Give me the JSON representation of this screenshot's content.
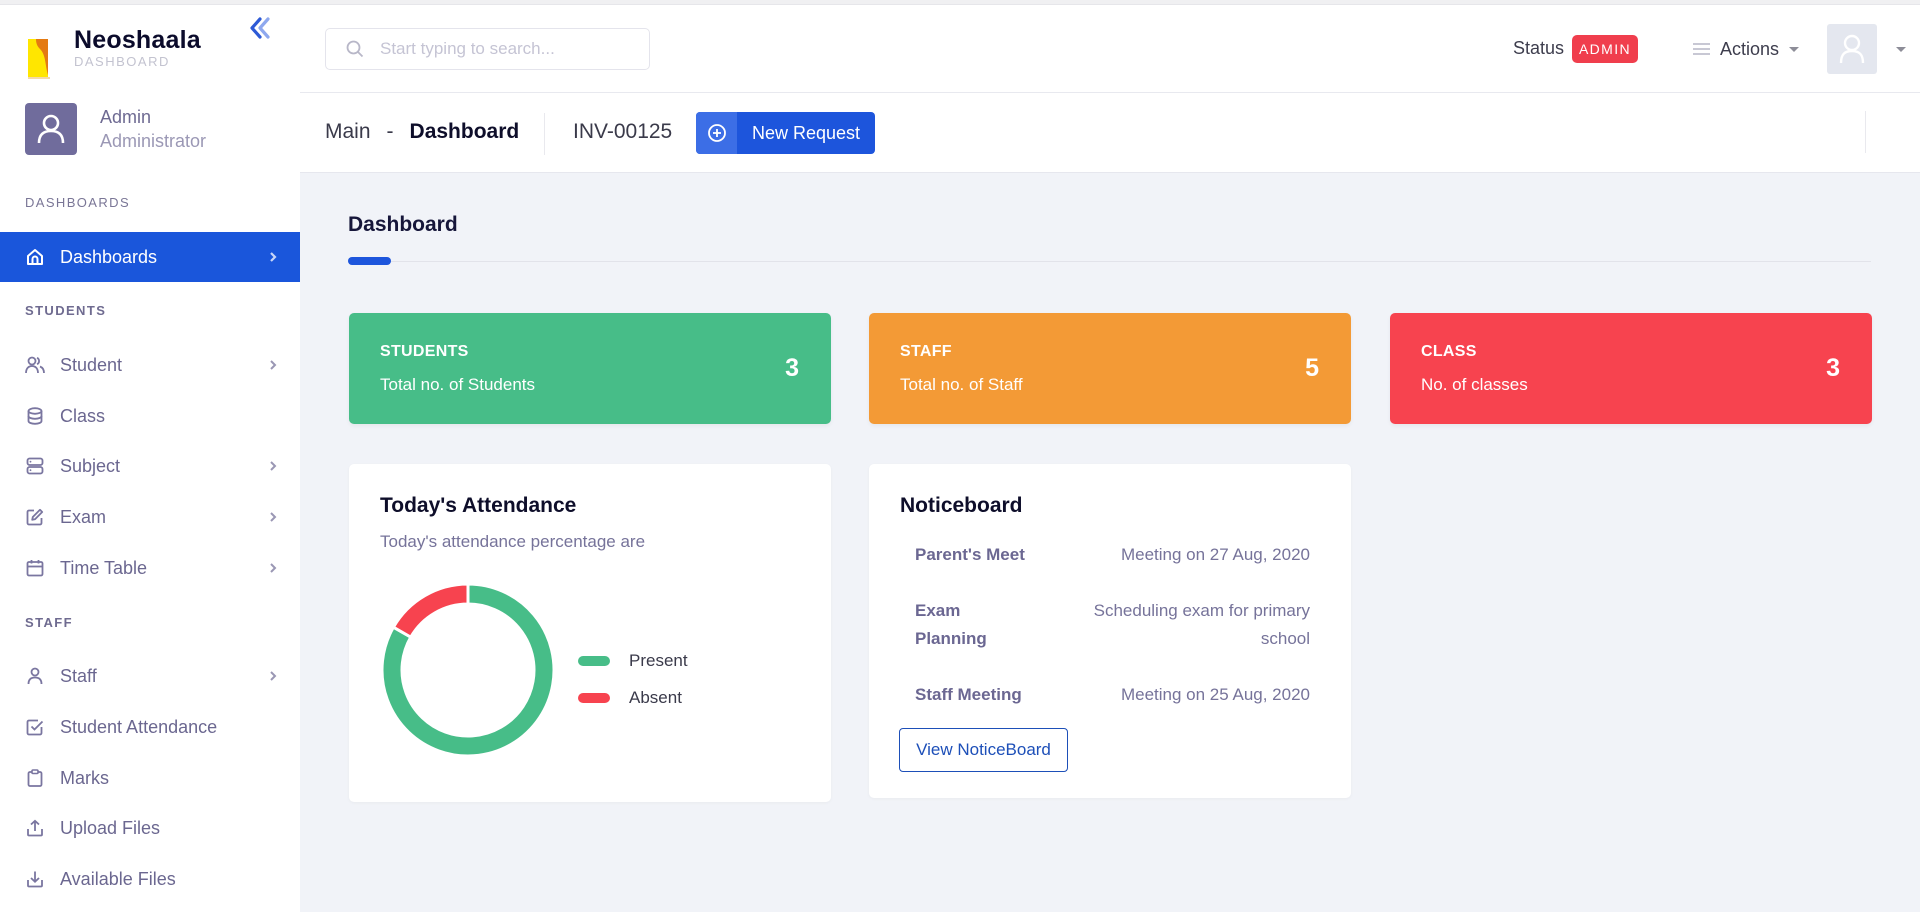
{
  "brand": {
    "name": "Neoshaala",
    "subtitle": "DASHBOARD"
  },
  "user": {
    "name": "Admin",
    "role": "Administrator"
  },
  "sidebar": {
    "sections": [
      {
        "label": "DASHBOARDS"
      },
      {
        "label": "STUDENTS"
      },
      {
        "label": "STAFF"
      }
    ],
    "items": [
      {
        "label": "Dashboards",
        "icon": "home-icon",
        "has_chevron": true,
        "active": true
      },
      {
        "label": "Student",
        "icon": "users-icon",
        "has_chevron": true
      },
      {
        "label": "Class",
        "icon": "database-icon",
        "has_chevron": false
      },
      {
        "label": "Subject",
        "icon": "server-icon",
        "has_chevron": true
      },
      {
        "label": "Exam",
        "icon": "edit-icon",
        "has_chevron": true
      },
      {
        "label": "Time Table",
        "icon": "calendar-icon",
        "has_chevron": true
      },
      {
        "label": "Staff",
        "icon": "user-icon",
        "has_chevron": true
      },
      {
        "label": "Student Attendance",
        "icon": "check-square-icon",
        "has_chevron": false
      },
      {
        "label": "Marks",
        "icon": "clipboard-icon",
        "has_chevron": false
      },
      {
        "label": "Upload Files",
        "icon": "upload-icon",
        "has_chevron": false
      },
      {
        "label": "Available Files",
        "icon": "download-icon",
        "has_chevron": false
      }
    ]
  },
  "header": {
    "search_placeholder": "Start typing to search...",
    "search_value": "",
    "status_label": "Status",
    "status_badge": "ADMIN",
    "actions_label": "Actions"
  },
  "subheader": {
    "breadcrumb_root": "Main",
    "breadcrumb_sep": "-",
    "breadcrumb_current": "Dashboard",
    "invoice_id": "INV-00125",
    "new_request_label": "New Request"
  },
  "main": {
    "title": "Dashboard",
    "stats": [
      {
        "title": "STUDENTS",
        "subtitle": "Total no. of Students",
        "value": "3",
        "color": "#47bd88"
      },
      {
        "title": "STAFF",
        "subtitle": "Total no. of Staff",
        "value": "5",
        "color": "#f39a36"
      },
      {
        "title": "CLASS",
        "subtitle": "No. of classes",
        "value": "3",
        "color": "#f7434f"
      }
    ],
    "attendance": {
      "title": "Today's Attendance",
      "subtitle": "Today's attendance percentage are"
    },
    "noticeboard": {
      "title": "Noticeboard",
      "items": [
        {
          "title": "Parent's Meet",
          "desc": "Meeting on 27 Aug, 2020"
        },
        {
          "title": "Exam Planning",
          "desc": "Scheduling exam for primary school"
        },
        {
          "title": "Staff Meeting",
          "desc": "Meeting on 25 Aug, 2020"
        }
      ],
      "view_button": "View NoticeBoard"
    }
  },
  "colors": {
    "accent": "#1a56db",
    "present": "#47bd88",
    "absent": "#f7434f",
    "badge": "#f03e4d"
  },
  "chart_data": {
    "type": "pie",
    "variant": "doughnut",
    "title": "Today's Attendance",
    "categories": [
      "Present",
      "Absent"
    ],
    "values": [
      83.3,
      16.7
    ],
    "unit": "percent",
    "colors": [
      "#47bd88",
      "#f7434f"
    ],
    "legend": "right"
  }
}
